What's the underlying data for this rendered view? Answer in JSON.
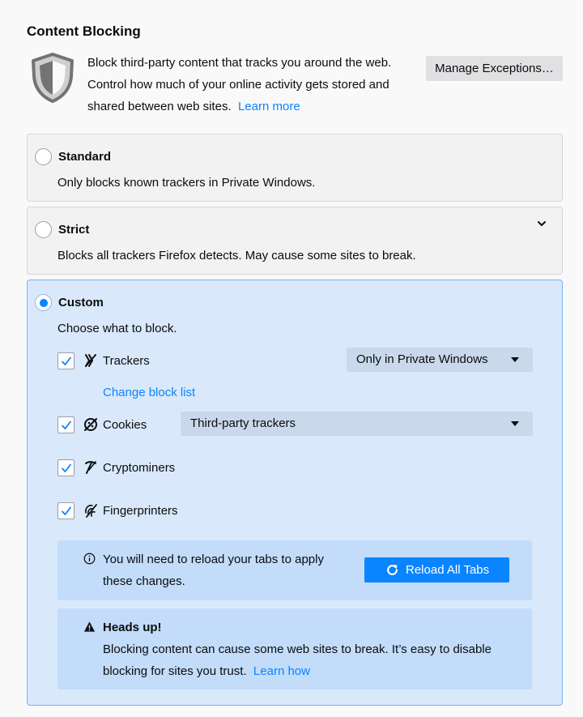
{
  "section": {
    "title": "Content Blocking",
    "intro_line1": "Block third-party content that tracks you around the web.",
    "intro_line2": "Control how much of your online activity gets stored and",
    "intro_line3": "shared between web sites.",
    "learn_more": "Learn more",
    "manage_exceptions": "Manage Exceptions…"
  },
  "options": {
    "standard": {
      "title": "Standard",
      "desc": "Only blocks known trackers in Private Windows.",
      "checked": false
    },
    "strict": {
      "title": "Strict",
      "desc": "Blocks all trackers Firefox detects. May cause some sites to break.",
      "checked": false
    },
    "custom": {
      "title": "Custom",
      "desc": "Choose what to block.",
      "checked": true
    }
  },
  "categories": {
    "trackers": {
      "label": "Trackers",
      "checked": true,
      "dropdown": "Only in Private Windows",
      "change_list": "Change block list"
    },
    "cookies": {
      "label": "Cookies",
      "checked": true,
      "dropdown": "Third-party trackers"
    },
    "cryptominers": {
      "label": "Cryptominers",
      "checked": true
    },
    "fingerprinters": {
      "label": "Fingerprinters",
      "checked": true
    }
  },
  "reload_notice": {
    "line1": "You will need to reload your tabs to apply",
    "line2": "these changes.",
    "button": "Reload All Tabs"
  },
  "warning": {
    "title": "Heads up!",
    "line1": "Blocking content can cause some web sites to break. It’s easy to disable",
    "line2": "blocking for sites you trust.",
    "learn_how": "Learn how"
  },
  "colors": {
    "accent": "#0a84ff",
    "selected_card": "#d9e8fb",
    "notice_bg": "#c2dcfa"
  },
  "icons": {
    "shield": "shield-icon",
    "chevron": "chevron-down-icon",
    "trackers": "trackers-icon",
    "cookies": "cookies-icon",
    "cryptominers": "cryptominers-icon",
    "fingerprinters": "fingerprinters-icon",
    "info": "info-icon",
    "warning": "warning-icon",
    "reload": "reload-icon"
  }
}
